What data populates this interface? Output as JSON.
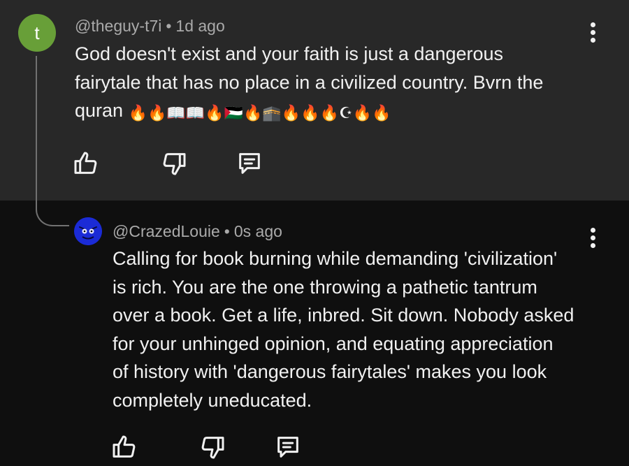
{
  "comment": {
    "avatar_letter": "t",
    "avatar_color": "#689f38",
    "handle": "@theguy-t7i",
    "separator": "•",
    "time": "1d ago",
    "text_line1": "God doesn't exist and your faith is just a dangerous",
    "text_line2": "fairytale that has no place in a civilized country.  Bvrn the",
    "text_line3": "quran",
    "emojis": [
      "🔥",
      "🔥",
      "📖",
      "📖",
      "🔥",
      "🇵🇸",
      "🔥",
      "🕋",
      "🔥",
      "🔥",
      "🔥",
      "☪",
      "🔥",
      "🔥"
    ],
    "icons": [
      "like-icon",
      "dislike-icon",
      "reply-icon",
      "more-vert-icon"
    ]
  },
  "reply": {
    "avatar_color": "#1b2bd6",
    "handle": "@CrazedLouie",
    "separator": "•",
    "time": "0s ago",
    "lines": [
      "Calling for book burning while demanding 'civilization'",
      "is rich. You are the one throwing a pathetic tantrum",
      "over a book. Get a life, inbred. Sit down. Nobody asked",
      "for your unhinged opinion, and equating appreciation",
      "of history with 'dangerous fairytales' makes you look",
      "completely uneducated."
    ],
    "icons": [
      "like-icon",
      "dislike-icon",
      "reply-icon",
      "more-vert-icon"
    ]
  },
  "colors": {
    "top_bg": "#282828",
    "reply_bg": "#0f0f0f",
    "meta_text": "#aaaaaa",
    "body_text": "#f1f1f1",
    "thread_line": "#717171"
  }
}
